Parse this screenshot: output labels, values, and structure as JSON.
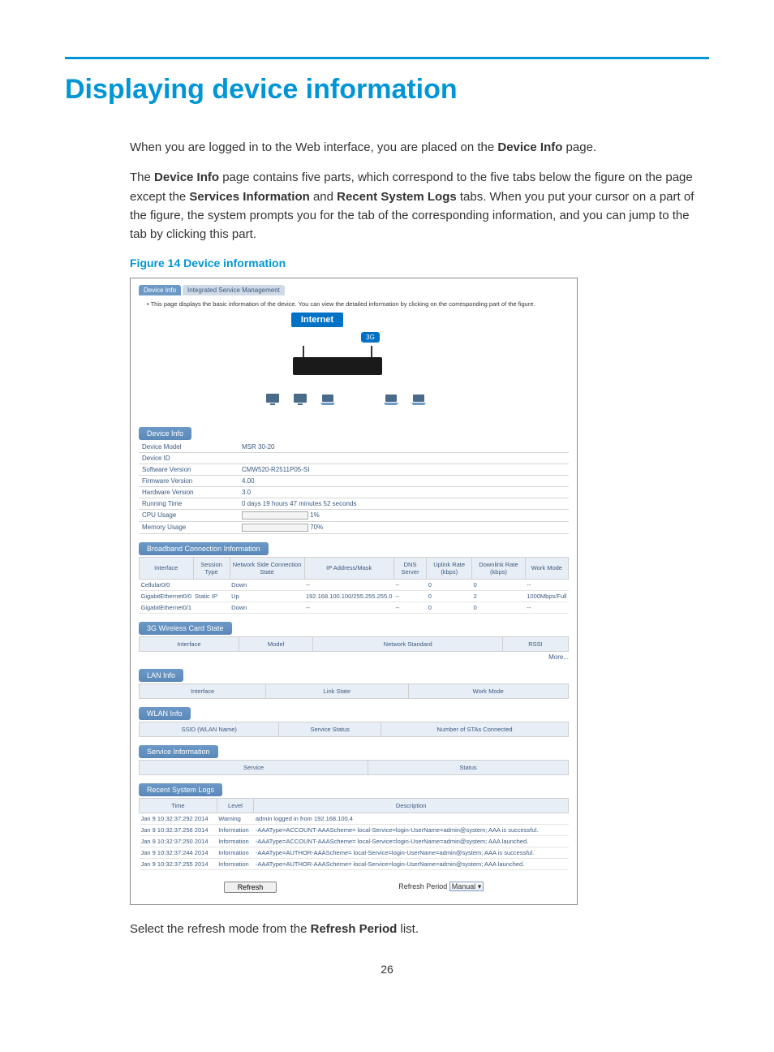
{
  "heading": "Displaying device information",
  "intro1_a": "When you are logged in to the Web interface, you are placed on the ",
  "intro1_b": "Device Info",
  "intro1_c": " page.",
  "intro2_a": "The ",
  "intro2_b": "Device Info",
  "intro2_c": " page contains five parts, which correspond to the five tabs below the figure on the page except the ",
  "intro2_d": "Services Information",
  "intro2_e": " and ",
  "intro2_f": "Recent System Logs",
  "intro2_g": " tabs. When you put your cursor on a part of the figure, the system prompts you for the tab of the corresponding information, and you can jump to the tab by clicking this part.",
  "figure_caption": "Figure 14 Device information",
  "tabs": {
    "active": "Device Info",
    "inactive": "Integrated Service Management"
  },
  "hint": "This page displays the basic information of the device. You can view the detailed information by clicking on the corresponding part of the figure.",
  "internet_label": "Internet",
  "threeg_label": "3G",
  "device_info_pill": "Device Info",
  "device_info": {
    "rows": [
      {
        "k": "Device Model",
        "v": "MSR 30-20"
      },
      {
        "k": "Device ID",
        "v": ""
      },
      {
        "k": "Software Version",
        "v": "CMW520-R2511P05-SI"
      },
      {
        "k": "Firmware Version",
        "v": "4.00"
      },
      {
        "k": "Hardware Version",
        "v": "3.0"
      },
      {
        "k": "Running Time",
        "v": "0 days 19 hours 47 minutes 52 seconds"
      }
    ],
    "cpu_label": "CPU Usage",
    "cpu_value": "1%",
    "mem_label": "Memory Usage",
    "mem_value": "70%"
  },
  "broadband_pill": "Broadband Connection Information",
  "broadband_headers": [
    "Interface",
    "Session Type",
    "Network Side Connection State",
    "IP Address/Mask",
    "DNS Server",
    "Uplink Rate (kbps)",
    "Downlink Rate (kbps)",
    "Work Mode"
  ],
  "broadband_rows": [
    {
      "c": [
        "Cellular0/0",
        "",
        "Down",
        "--",
        "--",
        "0",
        "0",
        "--"
      ]
    },
    {
      "c": [
        "GigabitEthernet0/0",
        "Static IP",
        "Up",
        "192.168.100.100/255.255.255.0",
        "--",
        "0",
        "2",
        "1000Mbps/Full"
      ]
    },
    {
      "c": [
        "GigabitEthernet0/1",
        "",
        "Down",
        "--",
        "--",
        "0",
        "0",
        "--"
      ]
    }
  ],
  "wireless_pill": "3G Wireless Card State",
  "wireless_headers": [
    "Interface",
    "Model",
    "Network Standard",
    "RSSI"
  ],
  "wireless_more": "More...",
  "lan_pill": "LAN Info",
  "lan_headers": [
    "Interface",
    "Link State",
    "Work Mode"
  ],
  "wlan_pill": "WLAN Info",
  "wlan_headers": [
    "SSID (WLAN Name)",
    "Service Status",
    "Number of STAs Connected"
  ],
  "service_pill": "Service Information",
  "service_headers": [
    "Service",
    "Status"
  ],
  "logs_pill": "Recent System Logs",
  "logs_headers": [
    "Time",
    "Level",
    "Description"
  ],
  "logs_rows": [
    {
      "c": [
        "Jan 9 10:32:37:292 2014",
        "Warning",
        "admin logged in from 192.168.100.4"
      ]
    },
    {
      "c": [
        "Jan 9 10:32:37:256 2014",
        "Information",
        "-AAAType=ACCOUNT-AAAScheme= local-Service=login-UserName=admin@system; AAA is successful."
      ]
    },
    {
      "c": [
        "Jan 9 10:32:37:250 2014",
        "Information",
        "-AAAType=ACCOUNT-AAAScheme= local-Service=login-UserName=admin@system; AAA launched."
      ]
    },
    {
      "c": [
        "Jan 9 10:32:37:244 2014",
        "Information",
        "-AAAType=AUTHOR-AAAScheme= local-Service=login-UserName=admin@system; AAA is successful."
      ]
    },
    {
      "c": [
        "Jan 9 10:32:37:255 2014",
        "Information",
        "-AAAType=AUTHOR-AAAScheme= local-Service=login-UserName=admin@system; AAA launched."
      ]
    }
  ],
  "refresh_button": "Refresh",
  "refresh_period_label": "Refresh Period",
  "refresh_period_value": "Manual",
  "closing_a": "Select the refresh mode from the ",
  "closing_b": "Refresh Period",
  "closing_c": " list.",
  "page_number": "26"
}
